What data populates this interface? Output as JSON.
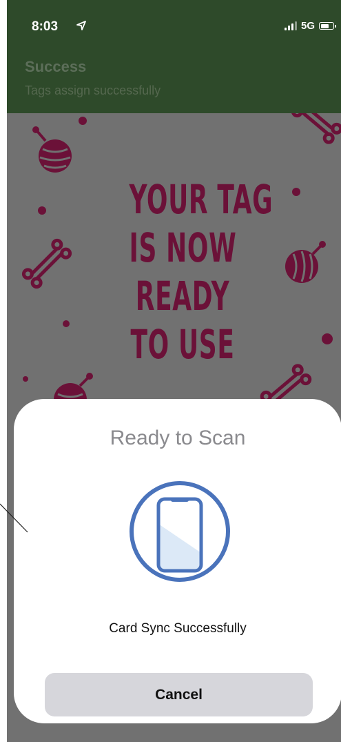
{
  "status_bar": {
    "time": "8:03",
    "network": "5G",
    "icons": [
      "location-arrow-icon",
      "signal-bars-icon",
      "battery-icon"
    ]
  },
  "header": {
    "title": "Success",
    "subtitle": "Tags assign successfully",
    "background_color": "#2e4a2a"
  },
  "poster": {
    "headline_lines": [
      "YOUR TAG",
      "IS NOW",
      "READY",
      "TO USE"
    ],
    "ink_color": "#6b1138",
    "decorations": [
      "yarn-ball-icon",
      "bone-icon",
      "dot"
    ]
  },
  "scan_sheet": {
    "title": "Ready to Scan",
    "message": "Card Sync Successfully",
    "cancel_label": "Cancel",
    "icon": "phone-scan-icon",
    "accent_color": "#4a73bb"
  }
}
